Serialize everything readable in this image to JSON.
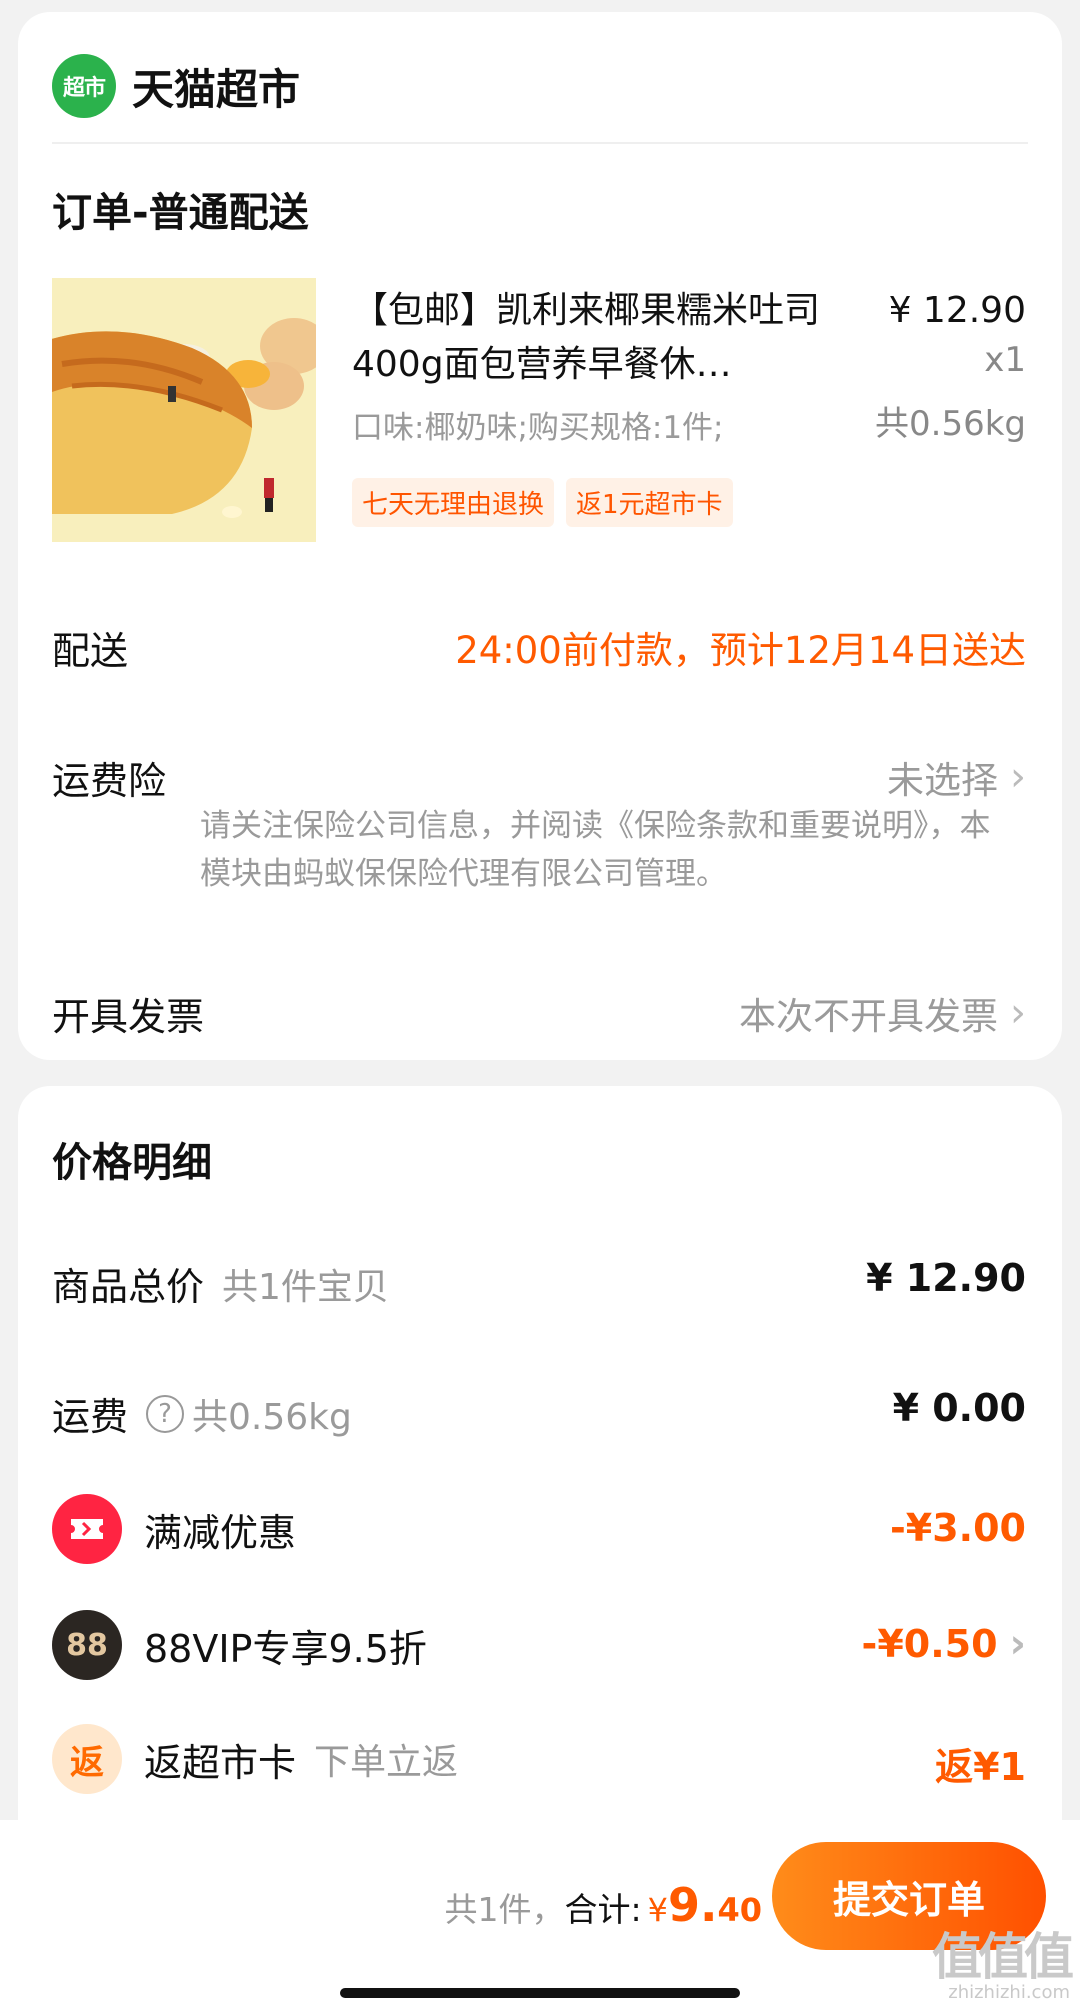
{
  "store": {
    "logo_text": "超市",
    "name": "天猫超市"
  },
  "order": {
    "section_title": "订单-普通配送",
    "product": {
      "title": "【包邮】凯利来椰果糯米吐司400g面包营养早餐休…",
      "price": "¥ 12.90",
      "quantity": "x1",
      "spec": "口味:椰奶味;购买规格:1件;",
      "weight": "共0.56kg",
      "tags": [
        "七天无理由退换",
        "返1元超市卡"
      ]
    },
    "delivery": {
      "label": "配送",
      "value": "24:00前付款，预计12月14日送达"
    },
    "insurance": {
      "label": "运费险",
      "value": "未选择",
      "note": "请关注保险公司信息，并阅读《保险条款和重要说明》，本模块由蚂蚁保保险代理有限公司管理。"
    },
    "invoice": {
      "label": "开具发票",
      "value": "本次不开具发票"
    }
  },
  "price_detail": {
    "title": "价格明细",
    "items_total": {
      "label": "商品总价",
      "sub": "共1件宝贝",
      "value": "¥ 12.90"
    },
    "shipping": {
      "label": "运费",
      "help_icon": "?",
      "sub": "共0.56kg",
      "value": "¥ 0.00"
    },
    "discount": {
      "label": "满减优惠",
      "value": "-¥3.00",
      "icon": "ticket-icon"
    },
    "vip": {
      "badge": "88",
      "label": "88VIP专享9.5折",
      "value": "-¥0.50"
    },
    "cashback": {
      "badge": "返",
      "label": "返超市卡",
      "sub": "下单立返",
      "value": "返¥1"
    }
  },
  "footer": {
    "count_label": "共1件，",
    "total_label": "合计:",
    "currency": "¥",
    "total_int": "9.",
    "total_cents": "40",
    "submit_label": "提交订单"
  },
  "watermark": {
    "mark": "值值值",
    "site": "zhizhizhi.com"
  },
  "colors": {
    "accent": "#ff5a00",
    "store_green": "#2bb24c",
    "discount_red": "#ff2442"
  }
}
